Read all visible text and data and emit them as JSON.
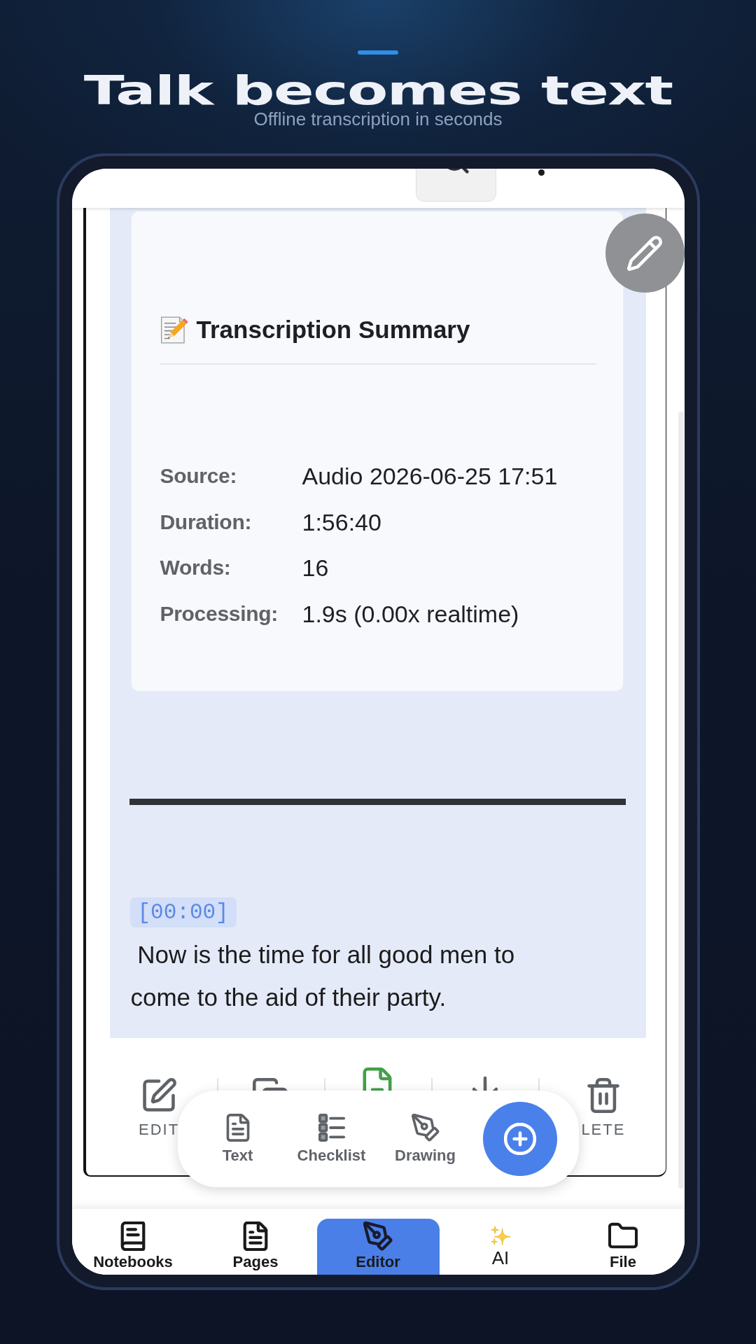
{
  "header": {
    "title": "Talk becomes text",
    "subtitle": "Offline transcription in seconds"
  },
  "summary": {
    "title": "Transcription Summary",
    "rows": [
      {
        "label": "Source:",
        "value": "Audio 2026-06-25 17:51"
      },
      {
        "label": "Duration:",
        "value": "1:56:40"
      },
      {
        "label": "Words:",
        "value": "16"
      },
      {
        "label": "Processing:",
        "value": "1.9s (0.00x realtime)"
      }
    ]
  },
  "transcript": {
    "timestamp": "[00:00]",
    "text": " Now is the time for all good men to come to the aid of their party."
  },
  "actions": [
    {
      "kind": "edit",
      "label": "EDIT"
    },
    {
      "kind": "copy"
    },
    {
      "kind": "export"
    },
    {
      "kind": "download"
    },
    {
      "kind": "delete",
      "label": "LETE"
    }
  ],
  "add_menu": [
    {
      "kind": "text",
      "label": "Text"
    },
    {
      "kind": "checklist",
      "label": "Checklist"
    },
    {
      "kind": "drawing",
      "label": "Drawing"
    }
  ],
  "bottom_nav": [
    {
      "kind": "notebooks",
      "label": "Notebooks",
      "selected": false
    },
    {
      "kind": "pages",
      "label": "Pages",
      "selected": false
    },
    {
      "kind": "editor",
      "label": "Editor",
      "selected": true
    },
    {
      "kind": "ai",
      "label": "AI",
      "selected": false
    },
    {
      "kind": "file",
      "label": "File",
      "selected": false
    }
  ]
}
